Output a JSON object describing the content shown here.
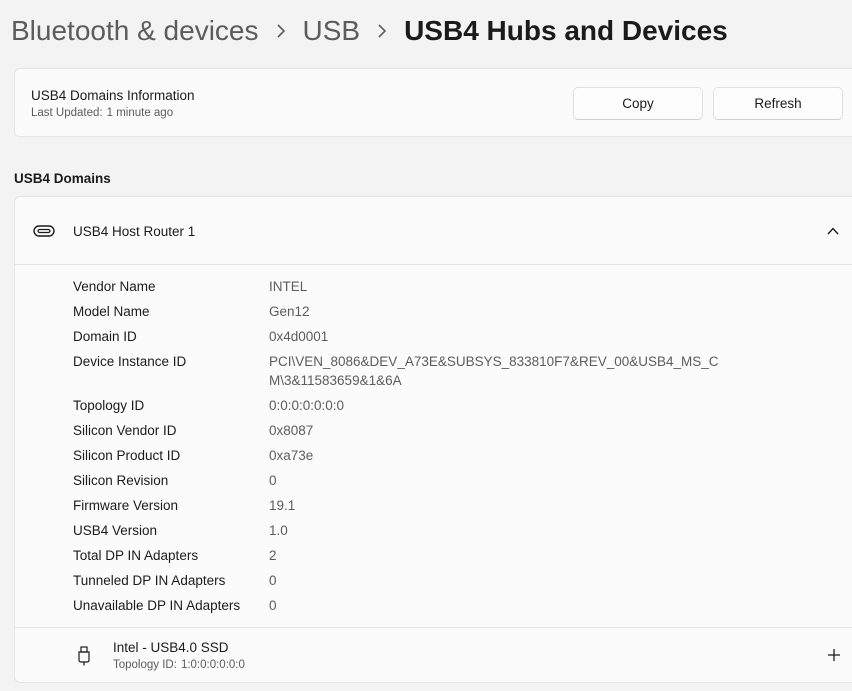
{
  "breadcrumb": {
    "items": [
      "Bluetooth & devices",
      "USB"
    ],
    "current": "USB4 Hubs and Devices"
  },
  "info_card": {
    "title": "USB4 Domains Information",
    "last_updated_label": "Last Updated:",
    "last_updated_value": "1 minute ago",
    "copy_label": "Copy",
    "refresh_label": "Refresh"
  },
  "section": {
    "title": "USB4 Domains"
  },
  "domain": {
    "icon": "usb-port-icon",
    "title": "USB4 Host Router 1",
    "expanded": true,
    "properties": [
      {
        "key": "Vendor Name",
        "value": "INTEL"
      },
      {
        "key": "Model Name",
        "value": "Gen12"
      },
      {
        "key": "Domain ID",
        "value": "0x4d0001"
      },
      {
        "key": "Device Instance ID",
        "value": "PCI\\VEN_8086&DEV_A73E&SUBSYS_833810F7&REV_00&USB4_MS_CM\\3&11583659&1&6A"
      },
      {
        "key": "Topology ID",
        "value": "0:0:0:0:0:0:0"
      },
      {
        "key": "Silicon Vendor ID",
        "value": "0x8087"
      },
      {
        "key": "Silicon Product ID",
        "value": "0xa73e"
      },
      {
        "key": "Silicon Revision",
        "value": "0"
      },
      {
        "key": "Firmware Version",
        "value": "19.1"
      },
      {
        "key": "USB4 Version",
        "value": "1.0"
      },
      {
        "key": "Total DP IN Adapters",
        "value": "2"
      },
      {
        "key": "Tunneled DP IN Adapters",
        "value": "0"
      },
      {
        "key": "Unavailable DP IN Adapters",
        "value": "0"
      }
    ],
    "device": {
      "icon": "usb-plug-icon",
      "name": "Intel - USB4.0 SSD",
      "topology_label": "Topology ID:",
      "topology_value": "1:0:0:0:0:0:0"
    }
  },
  "colors": {
    "background": "#f3f3f3",
    "card": "#fbfbfb",
    "border": "#e5e5e5",
    "text_primary": "#1b1b1b",
    "text_secondary": "#5c5c5c"
  }
}
